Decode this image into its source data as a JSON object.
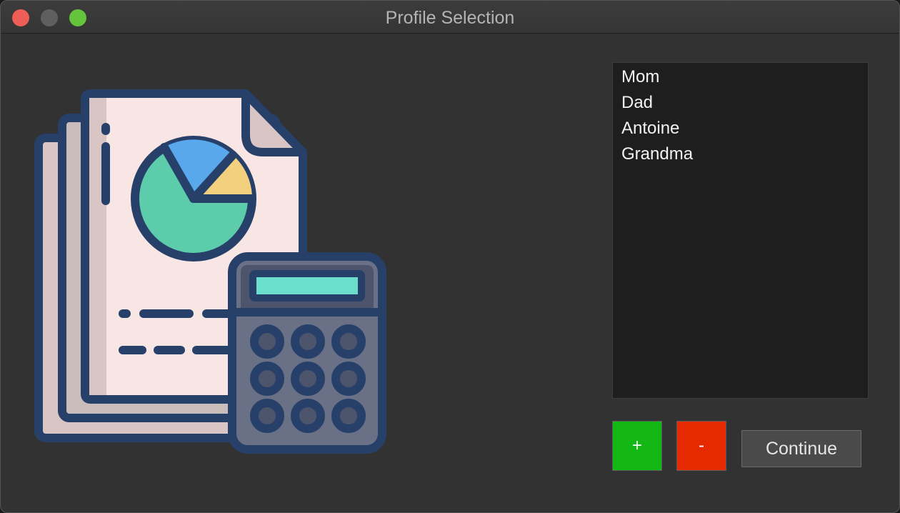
{
  "window": {
    "title": "Profile Selection"
  },
  "illustration": {
    "icon": "financial-report-calculator-icon"
  },
  "profiles": {
    "items": [
      "Mom",
      "Dad",
      "Antoine",
      "Grandma"
    ]
  },
  "buttons": {
    "add_label": "+",
    "remove_label": "-",
    "continue_label": "Continue"
  },
  "colors": {
    "add": "#14b814",
    "remove": "#e52a00",
    "list_background": "#1e1e1e",
    "window_background": "#323232"
  }
}
